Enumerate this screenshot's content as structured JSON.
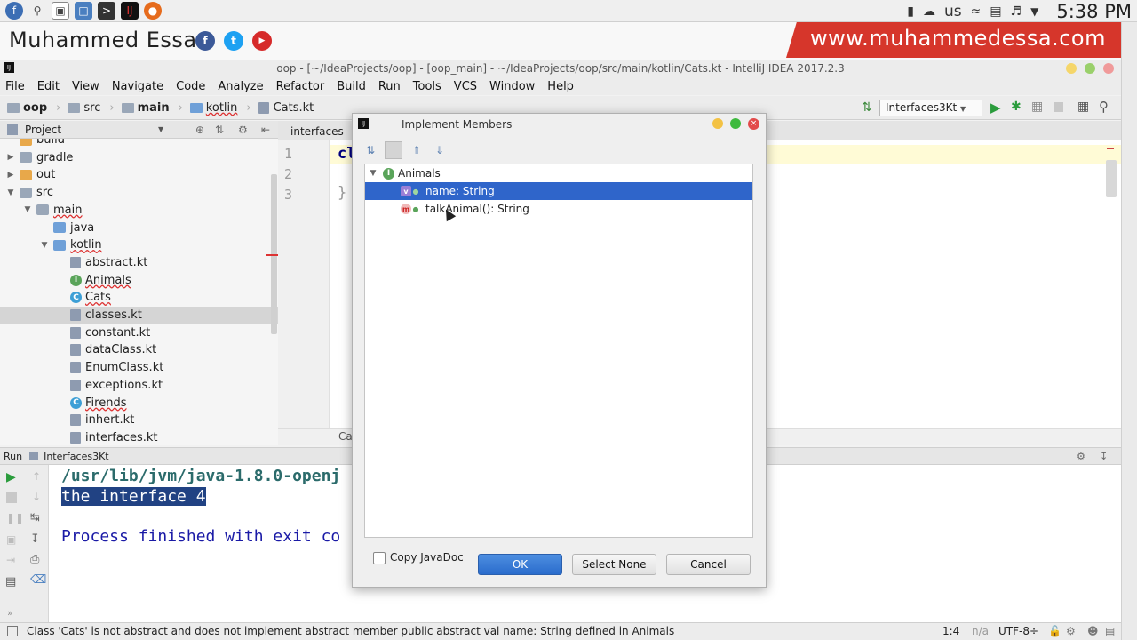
{
  "system_bar": {
    "language": "us",
    "time": "5:38 PM"
  },
  "banner": {
    "author": "Muhammed Essa",
    "website": "www.muhammedessa.com",
    "social": [
      "f",
      "t",
      "▶"
    ]
  },
  "window": {
    "title": "oop - [~/IdeaProjects/oop] - [oop_main] - ~/IdeaProjects/oop/src/main/kotlin/Cats.kt - IntelliJ IDEA 2017.2.3"
  },
  "menu": [
    "File",
    "Edit",
    "View",
    "Navigate",
    "Code",
    "Analyze",
    "Refactor",
    "Build",
    "Run",
    "Tools",
    "VCS",
    "Window",
    "Help"
  ],
  "breadcrumb": [
    "oop",
    "src",
    "main",
    "kotlin",
    "Cats.kt"
  ],
  "run_config": "Interfaces3Kt",
  "project_panel": {
    "title": "Project",
    "items": [
      {
        "label": "build",
        "kind": "folder-orange",
        "indent": 1,
        "arrow": ""
      },
      {
        "label": "gradle",
        "kind": "folder",
        "indent": 1,
        "arrow": "▶"
      },
      {
        "label": "out",
        "kind": "folder-orange",
        "indent": 1,
        "arrow": "▶"
      },
      {
        "label": "src",
        "kind": "folder",
        "indent": 1,
        "arrow": "▼"
      },
      {
        "label": "main",
        "kind": "folder",
        "indent": 2,
        "arrow": "▼"
      },
      {
        "label": "java",
        "kind": "folder-blue",
        "indent": 3,
        "arrow": ""
      },
      {
        "label": "kotlin",
        "kind": "folder-blue",
        "indent": 3,
        "arrow": "▼"
      },
      {
        "label": "abstract.kt",
        "kind": "kt",
        "indent": 4,
        "arrow": ""
      },
      {
        "label": "Animals",
        "kind": "interface",
        "indent": 4,
        "arrow": ""
      },
      {
        "label": "Cats",
        "kind": "class",
        "indent": 4,
        "arrow": ""
      },
      {
        "label": "classes.kt",
        "kind": "kt",
        "indent": 4,
        "arrow": "",
        "selected": true
      },
      {
        "label": "constant.kt",
        "kind": "kt",
        "indent": 4,
        "arrow": ""
      },
      {
        "label": "dataClass.kt",
        "kind": "kt",
        "indent": 4,
        "arrow": ""
      },
      {
        "label": "EnumClass.kt",
        "kind": "kt",
        "indent": 4,
        "arrow": ""
      },
      {
        "label": "exceptions.kt",
        "kind": "kt",
        "indent": 4,
        "arrow": ""
      },
      {
        "label": "Firends",
        "kind": "class",
        "indent": 4,
        "arrow": ""
      },
      {
        "label": "inhert.kt",
        "kind": "kt",
        "indent": 4,
        "arrow": ""
      },
      {
        "label": "interfaces.kt",
        "kind": "kt",
        "indent": 4,
        "arrow": ""
      }
    ]
  },
  "editor": {
    "tab_label": "interfaces",
    "line_numbers": [
      "1",
      "2",
      "3"
    ],
    "code_line1": "cl",
    "code_line3": "}",
    "footer_crumb": "Ca"
  },
  "run_panel": {
    "label": "Run",
    "config": "Interfaces3Kt",
    "console_lines": [
      "/usr/lib/jvm/java-1.8.0-openj",
      "the  interface 4",
      "",
      "Process finished with exit co"
    ]
  },
  "status_bar": {
    "message": "Class 'Cats' is not abstract and does not implement abstract member public abstract val name: String defined in Animals",
    "position": "1:4",
    "na": "n/a",
    "encoding": "UTF-8÷"
  },
  "dialog": {
    "title": "Implement Members",
    "root": "Animals",
    "members": [
      {
        "badge": "v",
        "label": "name: String",
        "selected": true
      },
      {
        "badge": "m",
        "label": "talkAnimal(): String",
        "selected": false
      }
    ],
    "copy_javadoc_label": "Copy JavaDoc",
    "copy_javadoc_checked": false,
    "ok_label": "OK",
    "select_none_label": "Select None",
    "cancel_label": "Cancel"
  },
  "colors": {
    "selection": "#2f65ca",
    "banner_red": "#d6362b",
    "console_path": "#2b6b6b",
    "console_text": "#1a1aa6"
  }
}
